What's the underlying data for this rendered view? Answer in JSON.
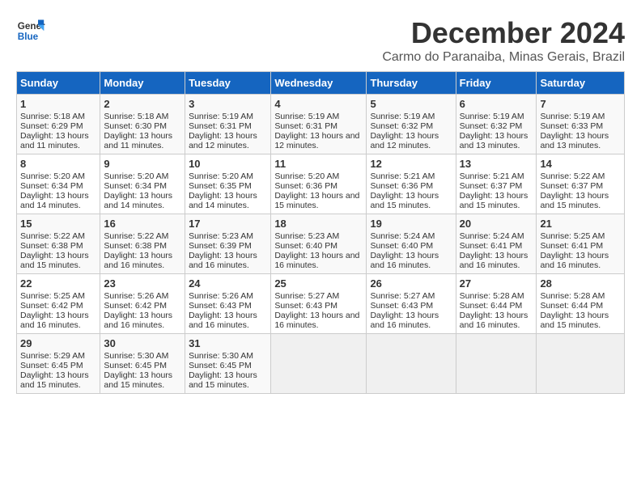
{
  "logo": {
    "line1": "General",
    "line2": "Blue"
  },
  "title": "December 2024",
  "subtitle": "Carmo do Paranaiba, Minas Gerais, Brazil",
  "days_header": [
    "Sunday",
    "Monday",
    "Tuesday",
    "Wednesday",
    "Thursday",
    "Friday",
    "Saturday"
  ],
  "weeks": [
    [
      {
        "day": "1",
        "info": "Sunrise: 5:18 AM\nSunset: 6:29 PM\nDaylight: 13 hours and 11 minutes."
      },
      {
        "day": "2",
        "info": "Sunrise: 5:18 AM\nSunset: 6:30 PM\nDaylight: 13 hours and 11 minutes."
      },
      {
        "day": "3",
        "info": "Sunrise: 5:19 AM\nSunset: 6:31 PM\nDaylight: 13 hours and 12 minutes."
      },
      {
        "day": "4",
        "info": "Sunrise: 5:19 AM\nSunset: 6:31 PM\nDaylight: 13 hours and 12 minutes."
      },
      {
        "day": "5",
        "info": "Sunrise: 5:19 AM\nSunset: 6:32 PM\nDaylight: 13 hours and 12 minutes."
      },
      {
        "day": "6",
        "info": "Sunrise: 5:19 AM\nSunset: 6:32 PM\nDaylight: 13 hours and 13 minutes."
      },
      {
        "day": "7",
        "info": "Sunrise: 5:19 AM\nSunset: 6:33 PM\nDaylight: 13 hours and 13 minutes."
      }
    ],
    [
      {
        "day": "8",
        "info": "Sunrise: 5:20 AM\nSunset: 6:34 PM\nDaylight: 13 hours and 14 minutes."
      },
      {
        "day": "9",
        "info": "Sunrise: 5:20 AM\nSunset: 6:34 PM\nDaylight: 13 hours and 14 minutes."
      },
      {
        "day": "10",
        "info": "Sunrise: 5:20 AM\nSunset: 6:35 PM\nDaylight: 13 hours and 14 minutes."
      },
      {
        "day": "11",
        "info": "Sunrise: 5:20 AM\nSunset: 6:36 PM\nDaylight: 13 hours and 15 minutes."
      },
      {
        "day": "12",
        "info": "Sunrise: 5:21 AM\nSunset: 6:36 PM\nDaylight: 13 hours and 15 minutes."
      },
      {
        "day": "13",
        "info": "Sunrise: 5:21 AM\nSunset: 6:37 PM\nDaylight: 13 hours and 15 minutes."
      },
      {
        "day": "14",
        "info": "Sunrise: 5:22 AM\nSunset: 6:37 PM\nDaylight: 13 hours and 15 minutes."
      }
    ],
    [
      {
        "day": "15",
        "info": "Sunrise: 5:22 AM\nSunset: 6:38 PM\nDaylight: 13 hours and 15 minutes."
      },
      {
        "day": "16",
        "info": "Sunrise: 5:22 AM\nSunset: 6:38 PM\nDaylight: 13 hours and 16 minutes."
      },
      {
        "day": "17",
        "info": "Sunrise: 5:23 AM\nSunset: 6:39 PM\nDaylight: 13 hours and 16 minutes."
      },
      {
        "day": "18",
        "info": "Sunrise: 5:23 AM\nSunset: 6:40 PM\nDaylight: 13 hours and 16 minutes."
      },
      {
        "day": "19",
        "info": "Sunrise: 5:24 AM\nSunset: 6:40 PM\nDaylight: 13 hours and 16 minutes."
      },
      {
        "day": "20",
        "info": "Sunrise: 5:24 AM\nSunset: 6:41 PM\nDaylight: 13 hours and 16 minutes."
      },
      {
        "day": "21",
        "info": "Sunrise: 5:25 AM\nSunset: 6:41 PM\nDaylight: 13 hours and 16 minutes."
      }
    ],
    [
      {
        "day": "22",
        "info": "Sunrise: 5:25 AM\nSunset: 6:42 PM\nDaylight: 13 hours and 16 minutes."
      },
      {
        "day": "23",
        "info": "Sunrise: 5:26 AM\nSunset: 6:42 PM\nDaylight: 13 hours and 16 minutes."
      },
      {
        "day": "24",
        "info": "Sunrise: 5:26 AM\nSunset: 6:43 PM\nDaylight: 13 hours and 16 minutes."
      },
      {
        "day": "25",
        "info": "Sunrise: 5:27 AM\nSunset: 6:43 PM\nDaylight: 13 hours and 16 minutes."
      },
      {
        "day": "26",
        "info": "Sunrise: 5:27 AM\nSunset: 6:43 PM\nDaylight: 13 hours and 16 minutes."
      },
      {
        "day": "27",
        "info": "Sunrise: 5:28 AM\nSunset: 6:44 PM\nDaylight: 13 hours and 16 minutes."
      },
      {
        "day": "28",
        "info": "Sunrise: 5:28 AM\nSunset: 6:44 PM\nDaylight: 13 hours and 15 minutes."
      }
    ],
    [
      {
        "day": "29",
        "info": "Sunrise: 5:29 AM\nSunset: 6:45 PM\nDaylight: 13 hours and 15 minutes."
      },
      {
        "day": "30",
        "info": "Sunrise: 5:30 AM\nSunset: 6:45 PM\nDaylight: 13 hours and 15 minutes."
      },
      {
        "day": "31",
        "info": "Sunrise: 5:30 AM\nSunset: 6:45 PM\nDaylight: 13 hours and 15 minutes."
      },
      {
        "day": "",
        "info": ""
      },
      {
        "day": "",
        "info": ""
      },
      {
        "day": "",
        "info": ""
      },
      {
        "day": "",
        "info": ""
      }
    ]
  ]
}
